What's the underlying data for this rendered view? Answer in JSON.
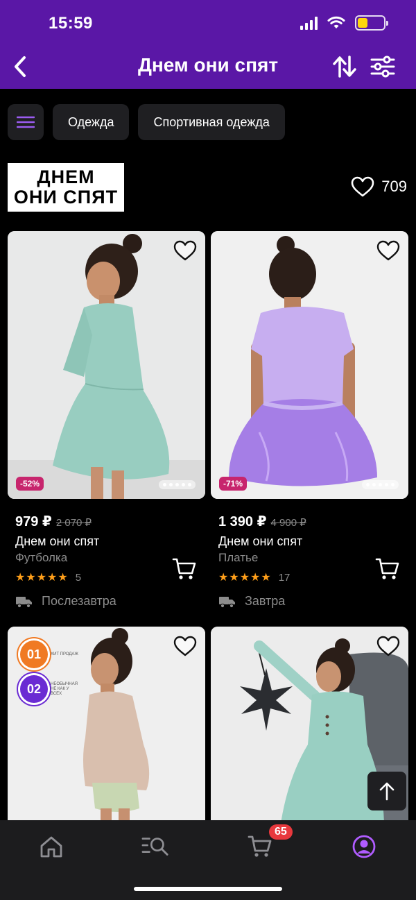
{
  "status_bar": {
    "time": "15:59"
  },
  "header": {
    "title": "Днем они спят"
  },
  "categories": [
    "Одежда",
    "Спортивная одежда"
  ],
  "brand": {
    "logo_line1": "ДНЕМ",
    "logo_line2": "ОНИ СПЯТ",
    "likes": "709"
  },
  "products": [
    {
      "price": "979 ₽",
      "old_price": "2 070 ₽",
      "brand": "Днем они спят",
      "type": "Футболка",
      "stars": "★★★★★",
      "reviews": "5",
      "delivery": "Послезавтра",
      "discount": "-52%",
      "image": "girl-mint-dress-photo"
    },
    {
      "price": "1 390 ₽",
      "old_price": "4 900 ₽",
      "brand": "Днем они спят",
      "type": "Платье",
      "stars": "★★★★★",
      "reviews": "17",
      "delivery": "Завтра",
      "discount": "-71%",
      "image": "girl-lavender-dress-photo"
    },
    {
      "image": "girl-beige-top-photo",
      "badges": [
        {
          "number": "01",
          "text": "Хит продаж",
          "color": "#f07a23"
        },
        {
          "number": "02",
          "text": "Необычная не как у всех",
          "color": "#6a2bd3"
        }
      ]
    },
    {
      "image": "girl-mint-long-dress-star-photo"
    }
  ],
  "tabbar": {
    "cart_count": "65",
    "active_color": "#b05cff"
  },
  "colors": {
    "header_bg": "#5a17a6",
    "accent": "#b05cff",
    "discount_bg": "#c7256d",
    "star": "#ff9f1a",
    "badge_red": "#e8383d"
  }
}
